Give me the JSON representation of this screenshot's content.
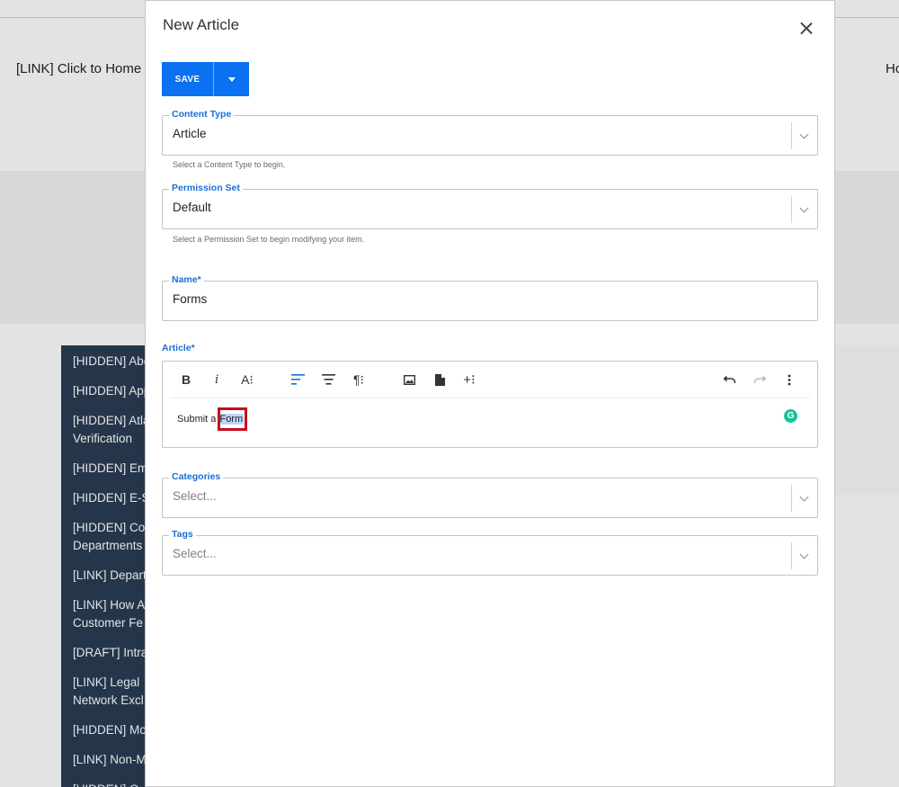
{
  "background": {
    "home_link": "[LINK] Click to Home",
    "right_link": "Ho",
    "sidebar_items": [
      "[HIDDEN] Abo",
      "[HIDDEN] App",
      "[HIDDEN] Atla\nVerification",
      "[HIDDEN] Em",
      "[HIDDEN] E-S",
      "[HIDDEN] Co\nDepartments",
      "[LINK] Depart",
      "[LINK] How A\nCustomer Fe",
      "[DRAFT] Intra",
      "[LINK] Legal\nNetwork Excl",
      "[HIDDEN] Mo",
      "[LINK] Non-M",
      "[HIDDEN] O"
    ]
  },
  "modal": {
    "title": "New Article",
    "save_label": "SAVE",
    "content_type": {
      "label": "Content Type",
      "value": "Article",
      "help": "Select a Content Type to begin."
    },
    "permission_set": {
      "label": "Permission Set",
      "value": "Default",
      "help": "Select a Permission Set to begin modifying your item."
    },
    "name": {
      "label": "Name*",
      "value": "Forms"
    },
    "article": {
      "label": "Article*",
      "content_prefix": "Submit a ",
      "content_selected": "Form",
      "grammarly": "G"
    },
    "categories": {
      "label": "Categories",
      "placeholder": "Select..."
    },
    "tags": {
      "label": "Tags",
      "placeholder": "Select..."
    }
  },
  "colors": {
    "accent": "#0a72f0",
    "label": "#1a6fd6",
    "selection": "#bcd6f6",
    "highlight_box": "#c60d1f",
    "sidebar": "#2a3d55"
  }
}
